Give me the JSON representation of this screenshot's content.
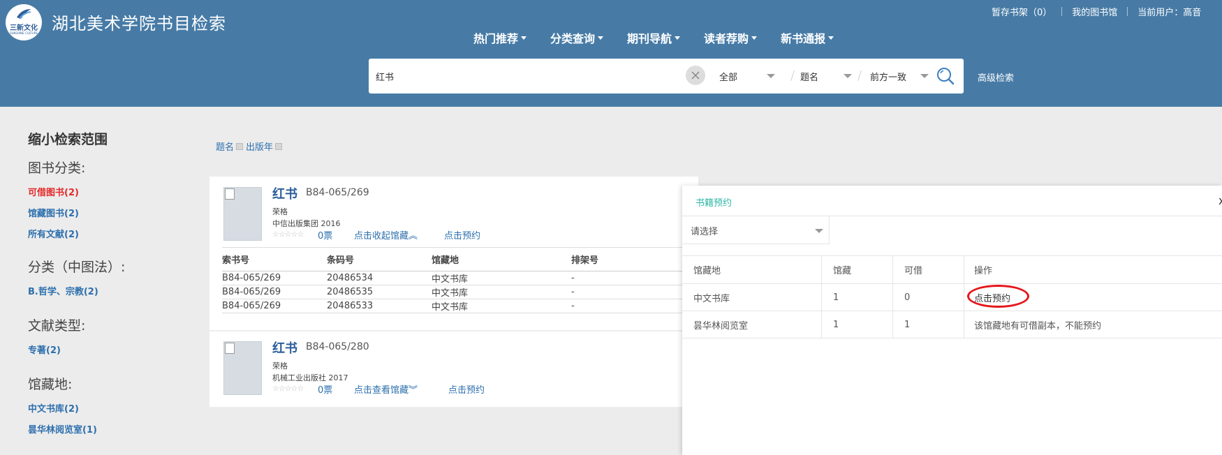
{
  "header": {
    "logo_text": "三新文化",
    "logo_sub": "SUNSHINE CULTURE",
    "site_title": "湖北美术学院书目检索",
    "bookshelf": "暂存书架（0）",
    "my_library": "我的图书馆",
    "current_user": "当前用户：高音"
  },
  "nav": {
    "items": [
      "热门推荐",
      "分类查询",
      "期刊导航",
      "读者荐购",
      "新书通报"
    ]
  },
  "search": {
    "query": "红书",
    "scope": "全部",
    "field": "题名",
    "match": "前方一致",
    "advanced": "高级检索"
  },
  "sidebar": {
    "title": "缩小检索范围",
    "book_category": {
      "heading": "图书分类:",
      "items": [
        "可借图书(2)",
        "馆藏图书(2)",
        "所有文献(2)"
      ]
    },
    "clc_category": {
      "heading": "分类（中图法）:",
      "items": [
        "B.哲学、宗教(2)"
      ]
    },
    "doc_type": {
      "heading": "文献类型:",
      "items": [
        "专著(2)"
      ]
    },
    "location": {
      "heading": "馆藏地:",
      "items": [
        "中文书库(2)",
        "昙华林阅览室(1)"
      ]
    }
  },
  "sortbar": {
    "items": [
      "题名",
      "出版年"
    ]
  },
  "results": [
    {
      "title": "红书",
      "call_number": "B84-065/269",
      "author": "荣格",
      "publisher_year": "中信出版集团  2016",
      "votes": "0票",
      "toggle_holdings": "点击收起馆藏︽",
      "reserve": "点击预约",
      "holdings": {
        "headers": [
          "索书号",
          "条码号",
          "馆藏地",
          "排架号"
        ],
        "rows": [
          [
            "B84-065/269",
            "20486534",
            "中文书库",
            "-"
          ],
          [
            "B84-065/269",
            "20486535",
            "中文书库",
            "-"
          ],
          [
            "B84-065/269",
            "20486533",
            "中文书库",
            "-"
          ]
        ]
      }
    },
    {
      "title": "红书",
      "call_number": "B84-065/280",
      "author": "荣格",
      "publisher_year": "机械工业出版社  2017",
      "votes": "0票",
      "toggle_holdings": "点击查看馆藏︾",
      "reserve": "点击预约"
    }
  ],
  "modal": {
    "title": "书籍预约",
    "close": "x",
    "select_placeholder": "请选择",
    "headers": [
      "馆藏地",
      "馆藏",
      "可借",
      "操作"
    ],
    "rows": [
      [
        "中文书库",
        "1",
        "0",
        "点击预约"
      ],
      [
        "昙华林阅览室",
        "1",
        "1",
        "该馆藏地有可借副本，不能预约"
      ]
    ]
  },
  "colors": {
    "header_bg": "#477ba6",
    "link": "#2c6fad",
    "title_link": "#2c5f9a",
    "available_red": "#e42a2a",
    "modal_title": "#2fb7a6",
    "annotation_ring": "#e5171c"
  }
}
